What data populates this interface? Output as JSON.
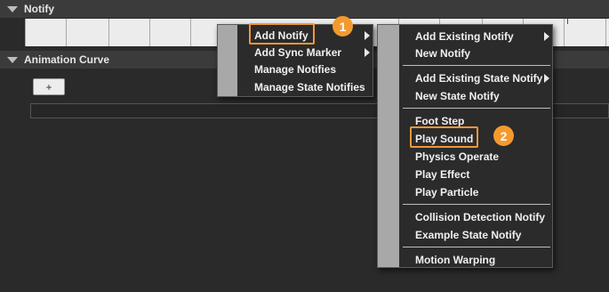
{
  "notify_section": {
    "title": "Notify"
  },
  "curve_section": {
    "title": "Animation Curve",
    "add_button_label": "+"
  },
  "notify_menu": {
    "items": [
      {
        "label": "Add Notify",
        "has_submenu": true
      },
      {
        "label": "Add Sync Marker",
        "has_submenu": true
      },
      {
        "label": "Manage Notifies",
        "has_submenu": false
      },
      {
        "label": "Manage State Notifies",
        "has_submenu": false
      }
    ]
  },
  "add_notify_submenu": {
    "items": [
      {
        "label": "Add Existing Notify",
        "has_submenu": true
      },
      {
        "label": "New Notify",
        "has_submenu": false
      },
      {
        "label": "Add Existing State Notify",
        "has_submenu": true
      },
      {
        "label": "New State Notify",
        "has_submenu": false
      },
      {
        "label": "Foot Step",
        "has_submenu": false
      },
      {
        "label": "Play Sound",
        "has_submenu": false
      },
      {
        "label": "Physics Operate",
        "has_submenu": false
      },
      {
        "label": "Play Effect",
        "has_submenu": false
      },
      {
        "label": "Play Particle",
        "has_submenu": false
      },
      {
        "label": "Collision Detection Notify",
        "has_submenu": false
      },
      {
        "label": "Example State Notify",
        "has_submenu": false
      },
      {
        "label": "Motion Warping",
        "has_submenu": false
      }
    ]
  },
  "callouts": [
    {
      "number": "1",
      "target": "Add Notify"
    },
    {
      "number": "2",
      "target": "Play Sound"
    }
  ],
  "colors": {
    "highlight": "#f0973a",
    "badge": "#f39a2f",
    "track_background": "#ececec",
    "menu_background": "#2b2b2b",
    "time_marker": "#d01a1a"
  }
}
